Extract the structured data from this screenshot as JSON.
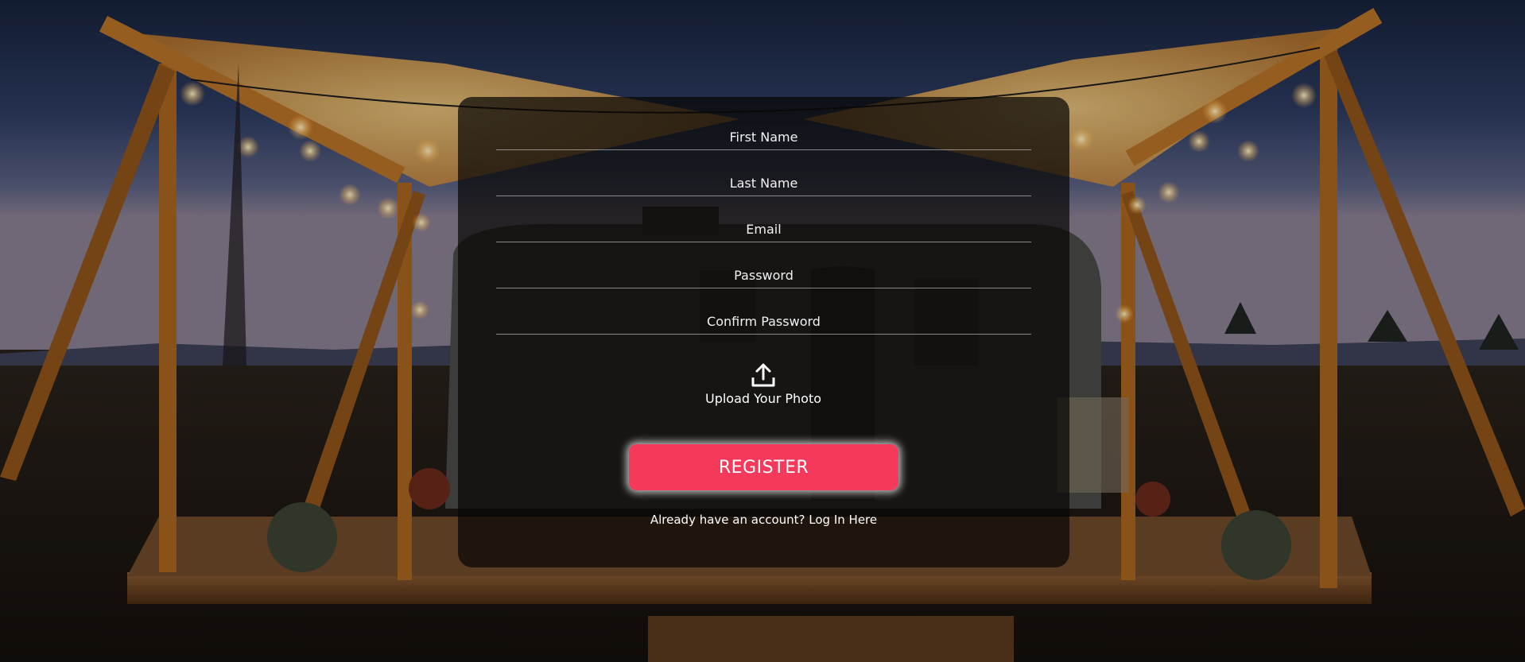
{
  "form": {
    "fields": [
      {
        "placeholder": "First Name",
        "value": ""
      },
      {
        "placeholder": "Last Name",
        "value": ""
      },
      {
        "placeholder": "Email",
        "value": ""
      },
      {
        "placeholder": "Password",
        "value": ""
      },
      {
        "placeholder": "Confirm Password",
        "value": ""
      }
    ],
    "upload_label": "Upload Your Photo",
    "upload_icon": "upload-icon",
    "register_label": "REGISTER",
    "login_prompt": "Already have an account?",
    "login_link": "Log In Here"
  },
  "colors": {
    "register_button": "#f4395b",
    "card_background": "rgba(8,7,5,0.72)",
    "text": "#ffffff"
  }
}
